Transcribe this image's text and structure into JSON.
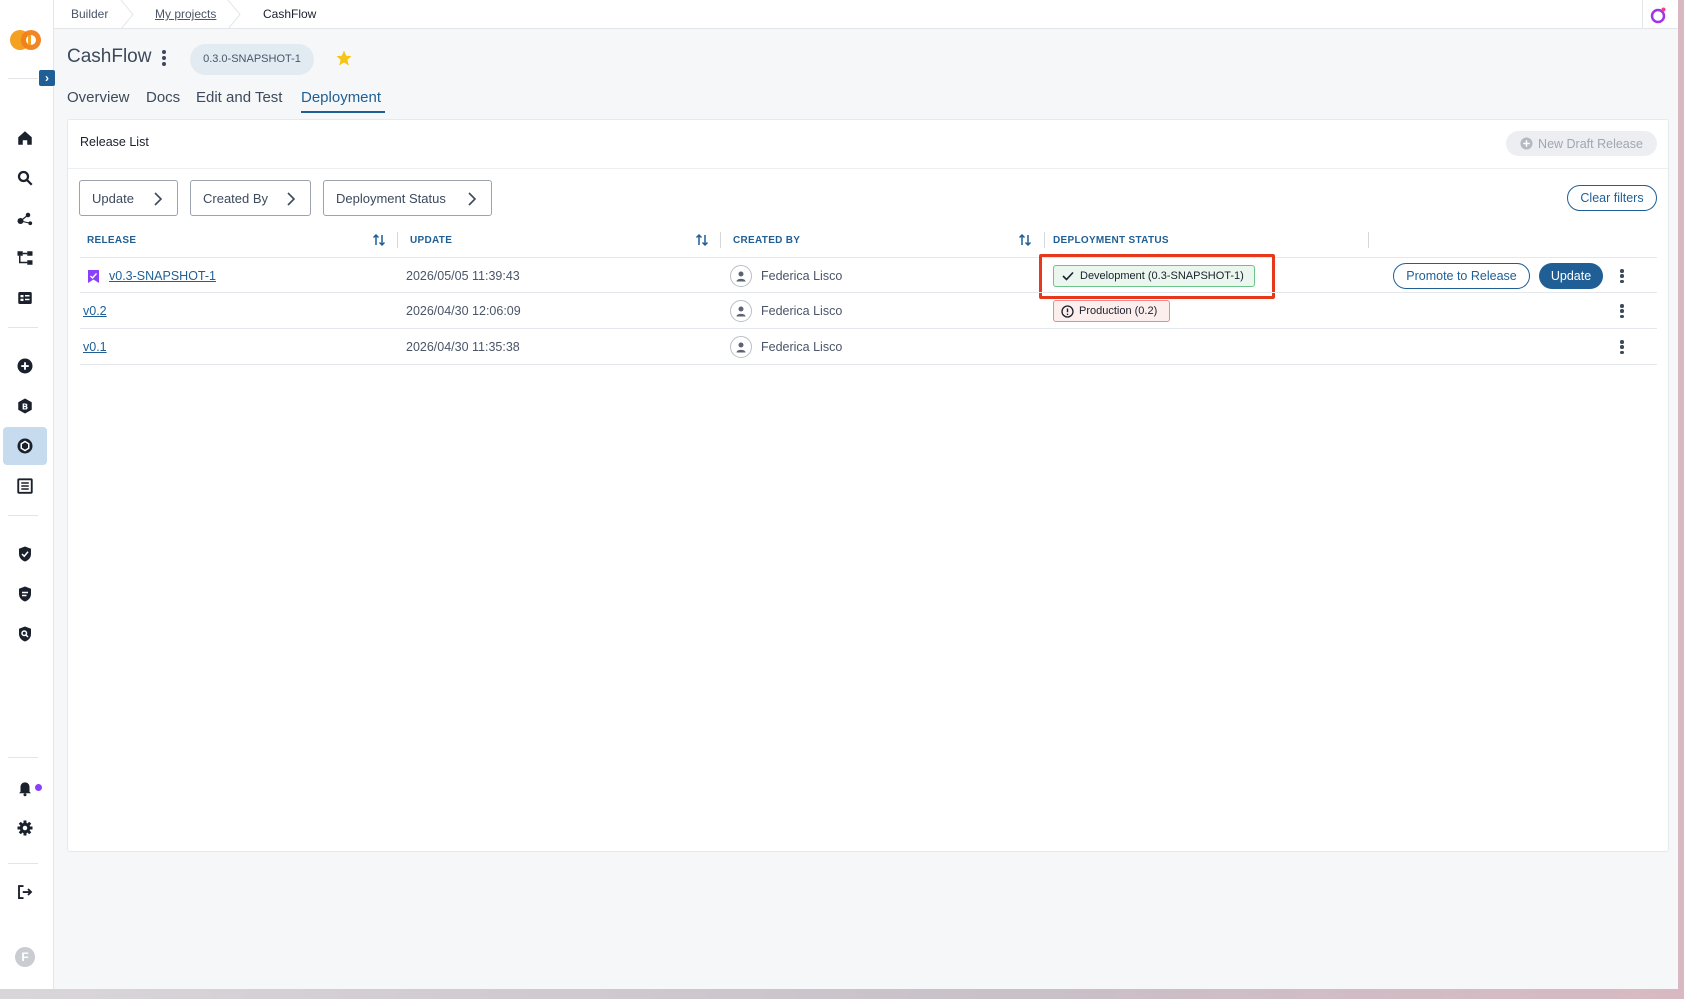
{
  "breadcrumb": {
    "builder": "Builder",
    "my_projects": "My projects",
    "current": "CashFlow"
  },
  "project": {
    "title": "CashFlow",
    "version": "0.3.0-SNAPSHOT-1",
    "starred": true
  },
  "tabs": [
    {
      "label": "Overview"
    },
    {
      "label": "Docs"
    },
    {
      "label": "Edit and Test"
    },
    {
      "label": "Deployment",
      "active": true
    }
  ],
  "release_list": {
    "title": "Release List",
    "new_draft_label": "New Draft Release",
    "clear_filters_label": "Clear filters",
    "filters": [
      {
        "label": "Update"
      },
      {
        "label": "Created By"
      },
      {
        "label": "Deployment Status"
      }
    ],
    "columns": [
      "RELEASE",
      "UPDATE",
      "CREATED BY",
      "DEPLOYMENT STATUS"
    ],
    "rows": [
      {
        "release": "v0.3-SNAPSHOT-1",
        "update": "2026/05/05 11:39:43",
        "created_by": "Federica Lisco",
        "status": "Development (0.3-SNAPSHOT-1)",
        "status_kind": "success",
        "draft": true
      },
      {
        "release": "v0.2",
        "update": "2026/04/30 12:06:09",
        "created_by": "Federica Lisco",
        "status": "Production (0.2)",
        "status_kind": "warning"
      },
      {
        "release": "v0.1",
        "update": "2026/04/30 11:35:38",
        "created_by": "Federica Lisco",
        "status": ""
      }
    ],
    "actions": {
      "promote_label": "Promote to Release",
      "update_label": "Update"
    }
  },
  "user": {
    "initial": "F"
  },
  "colors": {
    "primary": "#1f5f95",
    "success_bg": "#eaf6ee",
    "error_bg": "#fdeeee",
    "highlight": "#e8381c"
  }
}
